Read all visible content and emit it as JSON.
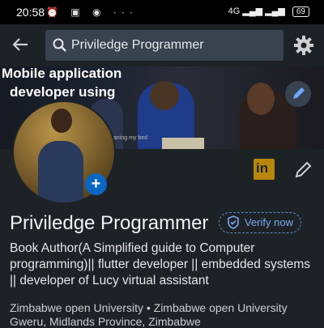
{
  "status_bar": {
    "time": "20:58",
    "network": "4G",
    "battery": "69"
  },
  "search": {
    "query": "Priviledge Programmer"
  },
  "cover": {
    "line1": "Mobile application",
    "line2": "developer using",
    "caption": "aning my bed"
  },
  "profile": {
    "name": "Priviledge Programmer",
    "verify_label": "Verify now",
    "headline": "Book Author(A Simplified guide to Computer programming)|| flutter developer || embedded systems || developer of Lucy virtual assistant",
    "education": "Zimbabwe open University  • Zimbabwe open University",
    "location": "Gweru, Midlands Province, Zimbabwe"
  },
  "linkedin_icon": {
    "text": "in"
  },
  "avatar_add_icon": "+"
}
